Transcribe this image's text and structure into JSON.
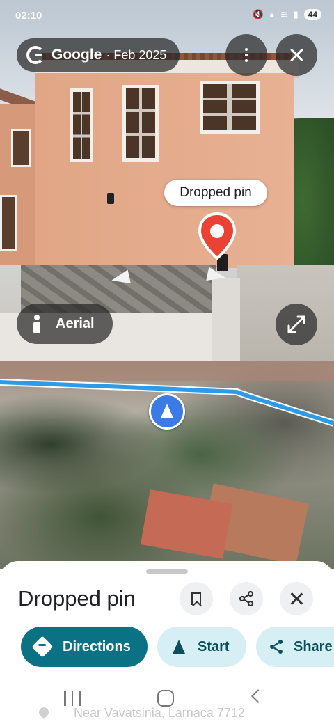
{
  "status_bar": {
    "time": "02:10",
    "battery": "44"
  },
  "header": {
    "source_name": "Google",
    "source_date": "· Feb 2025"
  },
  "streetview": {
    "pin_label": "Dropped pin",
    "aerial_label": "Aerial"
  },
  "sheet": {
    "title": "Dropped pin",
    "actions": {
      "directions": "Directions",
      "start": "Start",
      "share": "Share"
    },
    "address": "Near Vavatsinia, Larnaca 7712"
  },
  "colors": {
    "primary_teal": "#0b7285",
    "tonal_chip": "#d6eff4",
    "route_blue": "#2f9be8",
    "pin_red": "#ea4335"
  },
  "icons": [
    "google-icon",
    "more-vert-icon",
    "close-icon",
    "pin-icon",
    "person-icon",
    "expand-icon",
    "location-arrow-icon",
    "bookmark-icon",
    "share-icon",
    "directions-icon",
    "navigation-icon",
    "place-icon"
  ]
}
